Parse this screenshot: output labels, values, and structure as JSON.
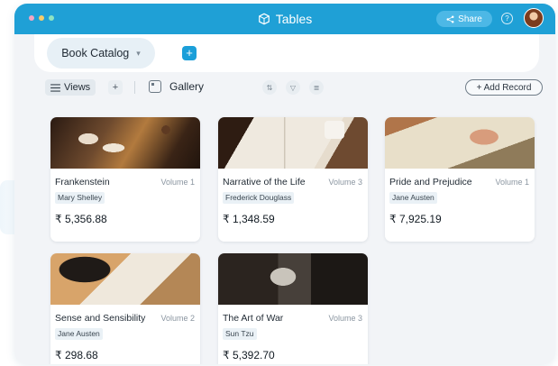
{
  "window": {
    "title": "Tables",
    "share_label": "Share",
    "help_label": "?"
  },
  "tabs": [
    {
      "label": "Book Catalog",
      "active": true
    }
  ],
  "toolbar": {
    "views_label": "Views",
    "add_view_label": "+",
    "gallery_label": "Gallery",
    "add_record_label": "+ Add Record",
    "add_tab_label": "+"
  },
  "colors": {
    "accent": "#1fa0d6",
    "background": "#f2f4f7",
    "card": "#ffffff",
    "author_badge": "#eaf1f6"
  },
  "cards": [
    {
      "title": "Frankenstein",
      "volume": "Volume 1",
      "author": "Mary Shelley",
      "price": "₹ 5,356.88"
    },
    {
      "title": "Narrative of the Life",
      "volume": "Volume 3",
      "author": "Frederick Douglass",
      "price": "₹ 1,348.59"
    },
    {
      "title": "Pride and Prejudice",
      "volume": "Volume 1",
      "author": "Jane Austen",
      "price": "₹ 7,925.19"
    },
    {
      "title": "Sense and Sensibility",
      "volume": "Volume 2",
      "author": "Jane Austen",
      "price": "₹ 298.68"
    },
    {
      "title": "The Art of War",
      "volume": "Volume 3",
      "author": "Sun Tzu",
      "price": "₹ 5,392.70"
    }
  ]
}
